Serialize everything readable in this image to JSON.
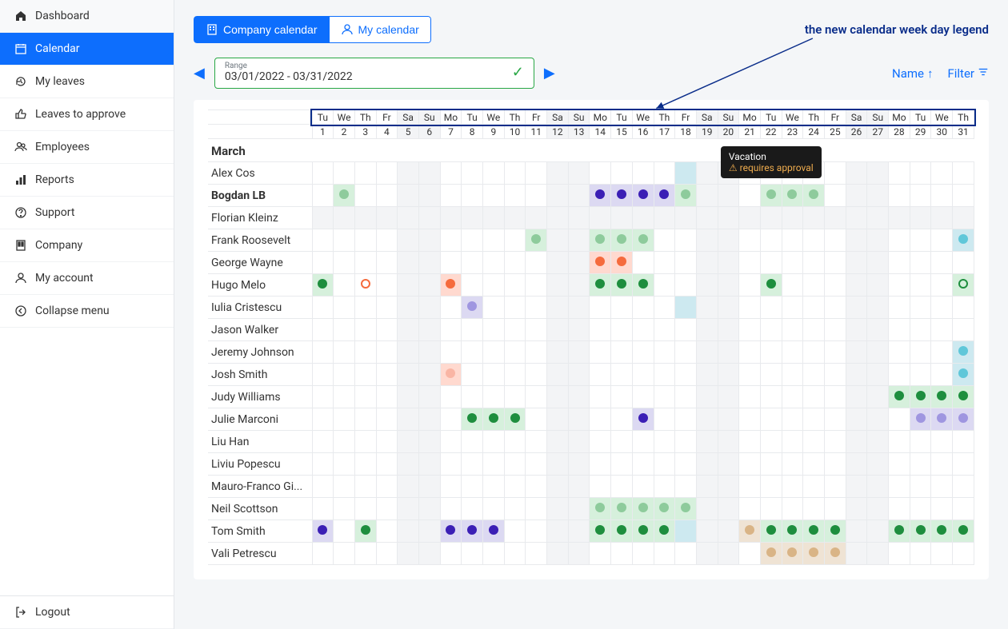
{
  "sidebar": {
    "items": [
      {
        "icon": "home",
        "label": "Dashboard"
      },
      {
        "icon": "calendar",
        "label": "Calendar",
        "active": true
      },
      {
        "icon": "history",
        "label": "My leaves"
      },
      {
        "icon": "thumbs-up",
        "label": "Leaves to approve"
      },
      {
        "icon": "users",
        "label": "Employees"
      },
      {
        "icon": "chart",
        "label": "Reports"
      },
      {
        "icon": "help",
        "label": "Support"
      },
      {
        "icon": "building",
        "label": "Company"
      },
      {
        "icon": "user",
        "label": "My account"
      },
      {
        "icon": "collapse",
        "label": "Collapse menu"
      }
    ],
    "logout": {
      "icon": "logout",
      "label": "Logout"
    }
  },
  "tabs": {
    "company": "Company calendar",
    "my": "My calendar"
  },
  "annotation": "the new calendar week day legend",
  "range": {
    "label": "Range",
    "value": "03/01/2022 - 03/31/2022"
  },
  "controls": {
    "name": "Name",
    "filter": "Filter"
  },
  "month": "March",
  "today_index": 6,
  "days": [
    {
      "wd": "Tu",
      "n": 1,
      "we": false
    },
    {
      "wd": "We",
      "n": 2,
      "we": false
    },
    {
      "wd": "Th",
      "n": 3,
      "we": false
    },
    {
      "wd": "Fr",
      "n": 4,
      "we": false
    },
    {
      "wd": "Sa",
      "n": 5,
      "we": true
    },
    {
      "wd": "Su",
      "n": 6,
      "we": true
    },
    {
      "wd": "Mo",
      "n": 7,
      "we": false
    },
    {
      "wd": "Tu",
      "n": 8,
      "we": false
    },
    {
      "wd": "We",
      "n": 9,
      "we": false
    },
    {
      "wd": "Th",
      "n": 10,
      "we": false
    },
    {
      "wd": "Fr",
      "n": 11,
      "we": false
    },
    {
      "wd": "Sa",
      "n": 12,
      "we": true
    },
    {
      "wd": "Su",
      "n": 13,
      "we": true
    },
    {
      "wd": "Mo",
      "n": 14,
      "we": false
    },
    {
      "wd": "Tu",
      "n": 15,
      "we": false
    },
    {
      "wd": "We",
      "n": 16,
      "we": false
    },
    {
      "wd": "Th",
      "n": 17,
      "we": false
    },
    {
      "wd": "Fr",
      "n": 18,
      "we": false
    },
    {
      "wd": "Sa",
      "n": 19,
      "we": true
    },
    {
      "wd": "Su",
      "n": 20,
      "we": true
    },
    {
      "wd": "Mo",
      "n": 21,
      "we": false
    },
    {
      "wd": "Tu",
      "n": 22,
      "we": false
    },
    {
      "wd": "We",
      "n": 23,
      "we": false
    },
    {
      "wd": "Th",
      "n": 24,
      "we": false
    },
    {
      "wd": "Fr",
      "n": 25,
      "we": false
    },
    {
      "wd": "Sa",
      "n": 26,
      "we": true
    },
    {
      "wd": "Su",
      "n": 27,
      "we": true
    },
    {
      "wd": "Mo",
      "n": 28,
      "we": false
    },
    {
      "wd": "Tu",
      "n": 29,
      "we": false
    },
    {
      "wd": "We",
      "n": 30,
      "we": false
    },
    {
      "wd": "Th",
      "n": 31,
      "we": false
    }
  ],
  "employees": [
    {
      "name": "Alex Cos",
      "cells": {
        "18": {
          "bg": "softblue"
        }
      }
    },
    {
      "name": "Bogdan LB",
      "bold": true,
      "cells": {
        "2": {
          "bg": "softgreen",
          "dot": "#8ecb9c"
        },
        "14": {
          "bg": "softpurple",
          "dot": "#3b1fb5"
        },
        "15": {
          "bg": "softpurple",
          "dot": "#3b1fb5"
        },
        "16": {
          "bg": "softpurple",
          "dot": "#3b1fb5"
        },
        "17": {
          "bg": "softpurple",
          "dot": "#3b1fb5"
        },
        "18": {
          "bg": "softgreen",
          "dot": "#8ecb9c"
        },
        "22": {
          "bg": "softgreen",
          "dot": "#8ecb9c",
          "tooltip": true
        },
        "23": {
          "bg": "softgreen",
          "dot": "#8ecb9c"
        },
        "24": {
          "bg": "softgreen",
          "dot": "#8ecb9c"
        }
      }
    },
    {
      "name": "Florian Kleinz",
      "weekend_all": true,
      "cells": {}
    },
    {
      "name": "Frank Roosevelt",
      "cells": {
        "11": {
          "bg": "softgreen",
          "dot": "#8ecb9c"
        },
        "14": {
          "bg": "softgreen",
          "dot": "#8ecb9c"
        },
        "15": {
          "bg": "softgreen",
          "dot": "#8ecb9c"
        },
        "16": {
          "bg": "softgreen",
          "dot": "#8ecb9c"
        },
        "31": {
          "bg": "softblue",
          "dot": "#5fc7d9"
        }
      }
    },
    {
      "name": "George Wayne",
      "cells": {
        "14": {
          "bg": "softorange",
          "dot": "#f56b3d"
        },
        "15": {
          "bg": "softorange",
          "dot": "#f56b3d"
        }
      }
    },
    {
      "name": "Hugo Melo",
      "cells": {
        "1": {
          "bg": "softgreen",
          "dot": "#1e8e3e"
        },
        "3": {
          "half": "orange"
        },
        "7": {
          "bg": "softorange",
          "dot": "#f56b3d"
        },
        "14": {
          "bg": "softgreen",
          "dot": "#1e8e3e"
        },
        "15": {
          "bg": "softgreen",
          "dot": "#1e8e3e"
        },
        "16": {
          "bg": "softgreen",
          "dot": "#1e8e3e"
        },
        "22": {
          "bg": "softgreen",
          "dot": "#1e8e3e"
        },
        "31": {
          "bg": "softgreen",
          "half": "green"
        }
      }
    },
    {
      "name": "Iulia Cristescu",
      "cells": {
        "8": {
          "bg": "softpurple",
          "dot": "#9f96e0"
        },
        "18": {
          "bg": "softblue"
        }
      }
    },
    {
      "name": "Jason Walker",
      "cells": {}
    },
    {
      "name": "Jeremy Johnson",
      "cells": {
        "31": {
          "bg": "softblue",
          "dot": "#5fc7d9"
        }
      }
    },
    {
      "name": "Josh Smith",
      "cells": {
        "7": {
          "bg": "softorange",
          "dot": "#f9b5a4"
        },
        "31": {
          "bg": "softblue",
          "dot": "#5fc7d9"
        }
      }
    },
    {
      "name": "Judy Williams",
      "cells": {
        "28": {
          "bg": "softgreen",
          "dot": "#1e8e3e"
        },
        "29": {
          "bg": "softgreen",
          "dot": "#1e8e3e"
        },
        "30": {
          "bg": "softgreen",
          "dot": "#1e8e3e"
        },
        "31": {
          "bg": "softgreen",
          "dot": "#1e8e3e"
        }
      }
    },
    {
      "name": "Julie Marconi",
      "cells": {
        "8": {
          "bg": "softgreen",
          "dot": "#1e8e3e"
        },
        "9": {
          "bg": "softgreen",
          "dot": "#1e8e3e"
        },
        "10": {
          "bg": "softgreen",
          "dot": "#1e8e3e"
        },
        "16": {
          "bg": "softpurple",
          "dot": "#3b1fb5"
        },
        "29": {
          "bg": "softpurple",
          "dot": "#9f96e0"
        },
        "30": {
          "bg": "softpurple",
          "dot": "#9f96e0"
        },
        "31": {
          "bg": "softpurple",
          "dot": "#9f96e0"
        }
      }
    },
    {
      "name": "Liu Han",
      "cells": {}
    },
    {
      "name": "Liviu Popescu",
      "cells": {}
    },
    {
      "name": "Mauro-Franco Gi...",
      "cells": {}
    },
    {
      "name": "Neil Scottson",
      "cells": {
        "14": {
          "bg": "softgreen",
          "dot": "#8ecb9c"
        },
        "15": {
          "bg": "softgreen",
          "dot": "#8ecb9c"
        },
        "16": {
          "bg": "softgreen",
          "dot": "#8ecb9c"
        },
        "17": {
          "bg": "softgreen",
          "dot": "#8ecb9c"
        },
        "18": {
          "bg": "softgreen",
          "dot": "#8ecb9c"
        }
      }
    },
    {
      "name": "Tom Smith",
      "cells": {
        "1": {
          "bg": "softpurple",
          "dot": "#3b1fb5"
        },
        "3": {
          "bg": "softgreen",
          "dot": "#1e8e3e"
        },
        "7": {
          "bg": "softpurple",
          "dot": "#3b1fb5"
        },
        "8": {
          "bg": "softpurple",
          "dot": "#3b1fb5"
        },
        "9": {
          "bg": "softpurple",
          "dot": "#3b1fb5"
        },
        "14": {
          "bg": "softgreen",
          "dot": "#1e8e3e"
        },
        "15": {
          "bg": "softgreen",
          "dot": "#1e8e3e"
        },
        "16": {
          "bg": "softgreen",
          "dot": "#1e8e3e"
        },
        "17": {
          "bg": "softgreen",
          "dot": "#1e8e3e"
        },
        "18": {
          "bg": "softblue"
        },
        "21": {
          "bg": "softtan",
          "dot": "#d9b486"
        },
        "22": {
          "bg": "softgreen",
          "dot": "#1e8e3e"
        },
        "23": {
          "bg": "softgreen",
          "dot": "#1e8e3e"
        },
        "24": {
          "bg": "softgreen",
          "dot": "#1e8e3e"
        },
        "25": {
          "bg": "softgreen",
          "dot": "#1e8e3e"
        },
        "28": {
          "bg": "softgreen",
          "dot": "#1e8e3e"
        },
        "29": {
          "bg": "softgreen",
          "dot": "#1e8e3e"
        },
        "30": {
          "bg": "softgreen",
          "dot": "#1e8e3e"
        },
        "31": {
          "bg": "softgreen",
          "dot": "#1e8e3e"
        }
      }
    },
    {
      "name": "Vali Petrescu",
      "cells": {
        "22": {
          "bg": "softtan",
          "dot": "#d9b486"
        },
        "23": {
          "bg": "softtan",
          "dot": "#d9b486"
        },
        "24": {
          "bg": "softtan",
          "dot": "#d9b486"
        },
        "25": {
          "bg": "softtan",
          "dot": "#d9b486"
        }
      }
    }
  ],
  "tooltip": {
    "title": "Vacation",
    "warn": "requires approval"
  }
}
